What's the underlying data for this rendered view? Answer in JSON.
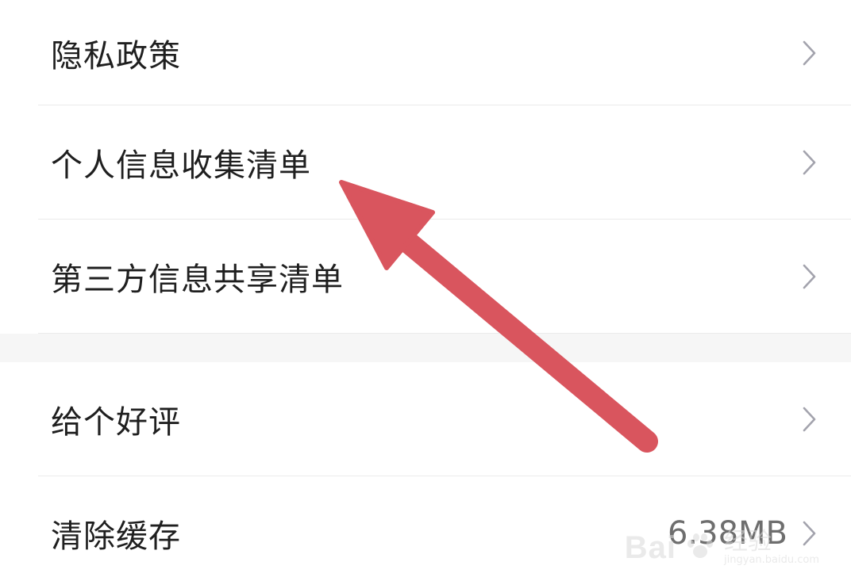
{
  "settings": {
    "group_one": [
      {
        "label": "隐私政策"
      },
      {
        "label": "个人信息收集清单"
      },
      {
        "label": "第三方信息共享清单"
      }
    ],
    "group_two": [
      {
        "label": "给个好评"
      },
      {
        "label": "清除缓存",
        "value": "6.38MB"
      }
    ]
  },
  "annotation": {
    "arrow_color": "#d9555e"
  },
  "watermark": {
    "brand": "Bai",
    "cn": "经验",
    "url": "jingyan.baidu.com"
  },
  "icons": {
    "chevron": "chevron-right-icon",
    "paw": "paw-icon"
  }
}
